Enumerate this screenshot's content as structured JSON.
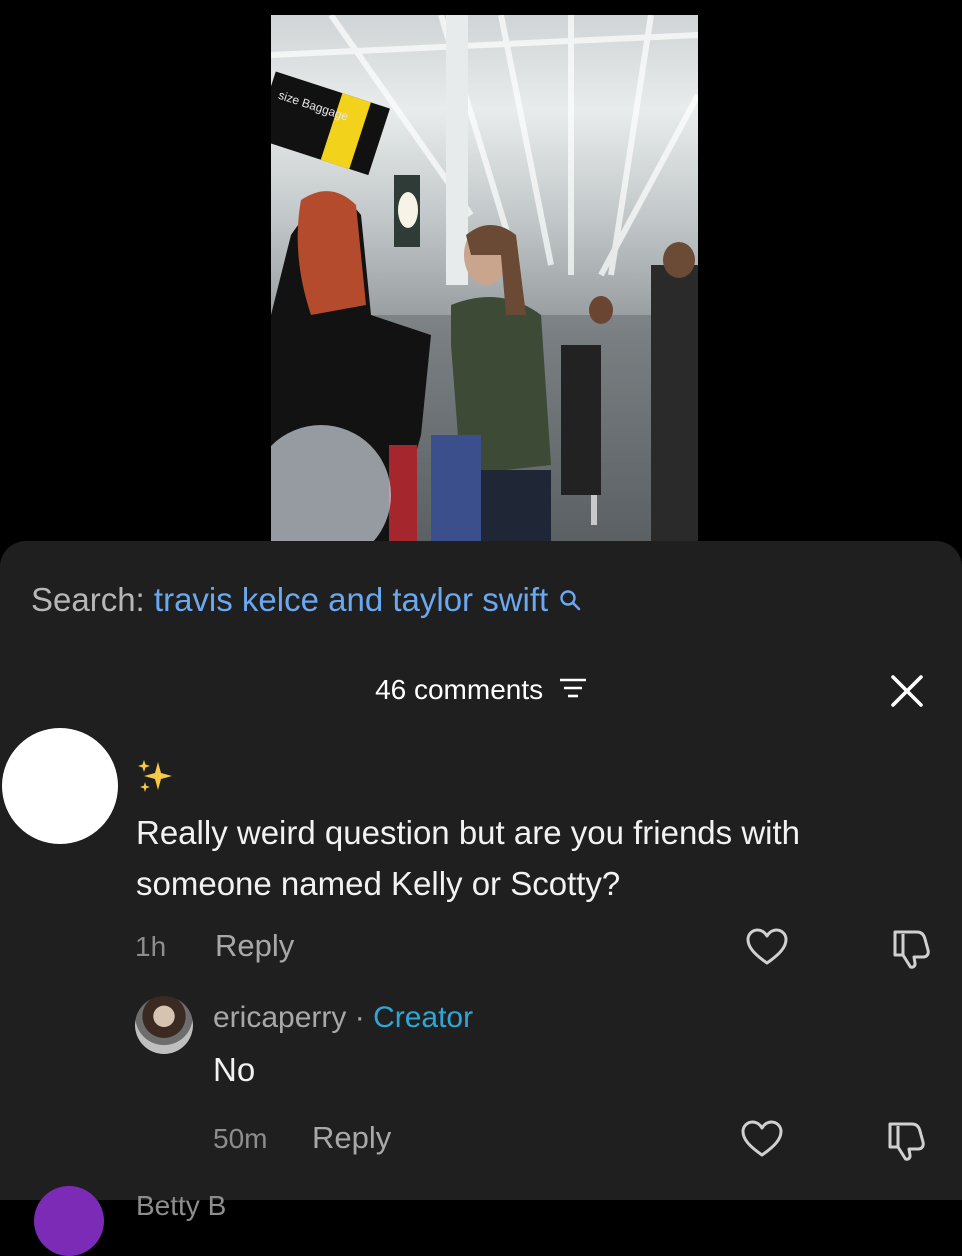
{
  "video": {
    "description_icon": "video-frame",
    "sign_text": "size Baggage"
  },
  "search": {
    "prefix": "Search:",
    "query": "travis kelce and taylor swift",
    "icon": "search-icon"
  },
  "comments": {
    "count_label": "46 comments",
    "filter_icon": "filter-icon",
    "close_icon": "close-icon"
  },
  "comment": {
    "emoji": "✨",
    "text": "Really weird question but are you friends with someone named Kelly or Scotty?",
    "time": "1h",
    "reply_label": "Reply"
  },
  "reply": {
    "author": "ericaperry",
    "separator": "·",
    "badge": "Creator",
    "text": "No",
    "time": "50m",
    "reply_label": "Reply"
  },
  "next_comment": {
    "name_partial": "Betty B"
  },
  "colors": {
    "sheet_bg": "#1f1f1f",
    "link_blue": "#6aa8f0",
    "creator_blue": "#2ea7d6",
    "muted": "#8d8d8d"
  }
}
